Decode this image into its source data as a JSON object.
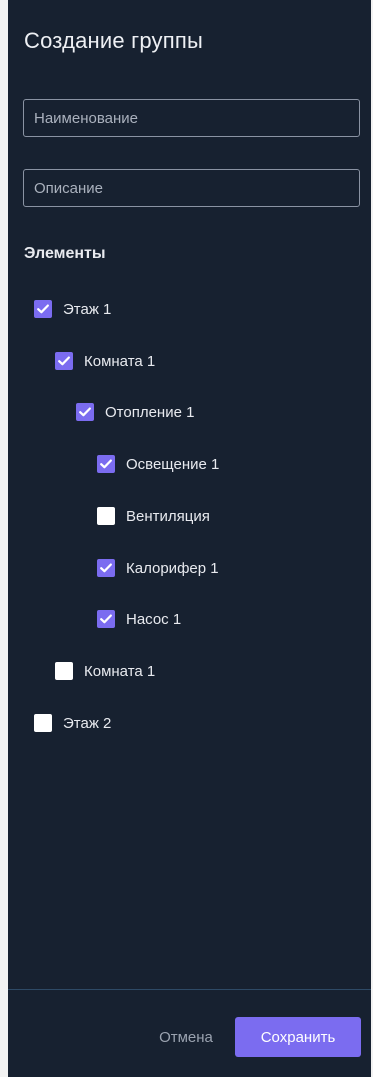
{
  "dialog": {
    "title": "Создание группы"
  },
  "form": {
    "name_placeholder": "Наименование",
    "name_value": "",
    "description_placeholder": "Описание",
    "description_value": ""
  },
  "elements": {
    "label": "Элементы",
    "items": [
      {
        "label": "Этаж 1",
        "checked": true,
        "level": 0
      },
      {
        "label": "Комната 1",
        "checked": true,
        "level": 1
      },
      {
        "label": "Отопление 1",
        "checked": true,
        "level": 2
      },
      {
        "label": "Освещение 1",
        "checked": true,
        "level": 3
      },
      {
        "label": "Вентиляция",
        "checked": false,
        "level": 3
      },
      {
        "label": "Калорифер 1",
        "checked": true,
        "level": 3
      },
      {
        "label": "Насос 1",
        "checked": true,
        "level": 3
      },
      {
        "label": "Комната 1",
        "checked": false,
        "level": 1
      },
      {
        "label": "Этаж 2",
        "checked": false,
        "level": 0
      }
    ]
  },
  "footer": {
    "cancel_label": "Отмена",
    "save_label": "Сохранить"
  },
  "colors": {
    "panel_bg": "#172130",
    "accent": "#7b6cf0",
    "divider": "#2e4a66"
  }
}
